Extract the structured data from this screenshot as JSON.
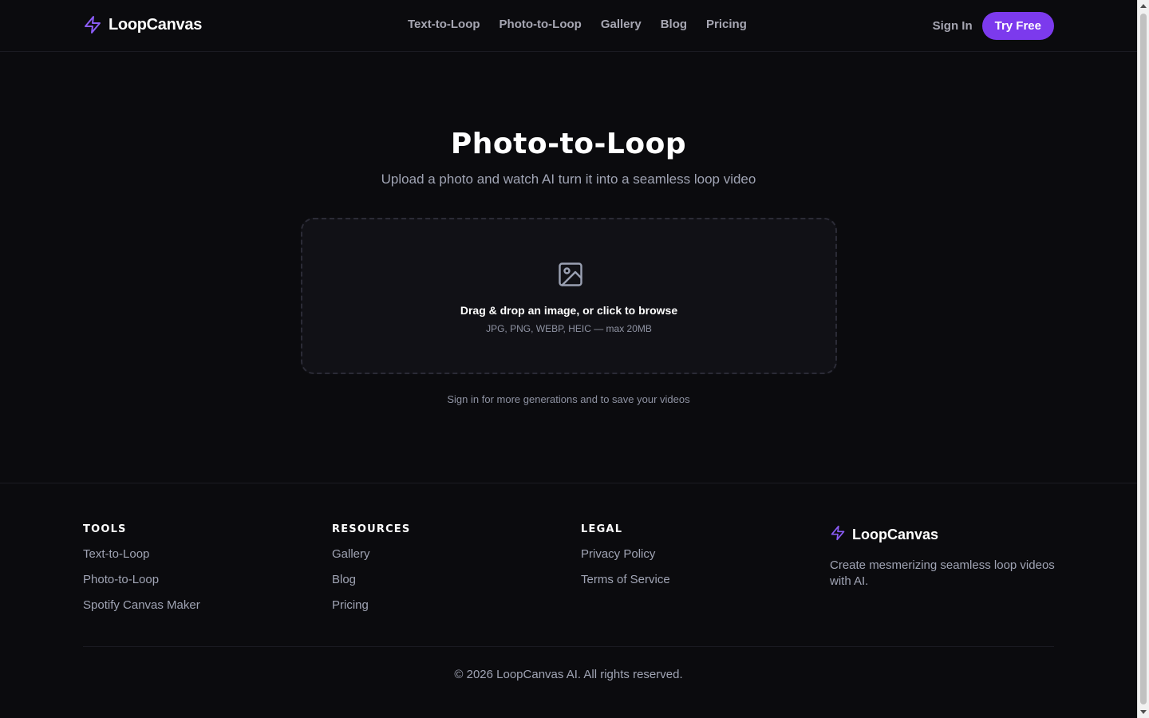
{
  "header": {
    "brand": "LoopCanvas",
    "nav": [
      "Text-to-Loop",
      "Photo-to-Loop",
      "Gallery",
      "Blog",
      "Pricing"
    ],
    "sign_in": "Sign In",
    "try_free": "Try Free"
  },
  "hero": {
    "title": "Photo-to-Loop",
    "subtitle": "Upload a photo and watch AI turn it into a seamless loop video"
  },
  "upload": {
    "icon": "image-icon",
    "title": "Drag & drop an image, or click to browse",
    "hint": "JPG, PNG, WEBP, HEIC — max 20MB"
  },
  "note": "Sign in for more generations and to save your videos",
  "footer": {
    "tools": {
      "heading": "TOOLS",
      "links": [
        "Text-to-Loop",
        "Photo-to-Loop",
        "Spotify Canvas Maker"
      ]
    },
    "resources": {
      "heading": "RESOURCES",
      "links": [
        "Gallery",
        "Blog",
        "Pricing"
      ]
    },
    "legal": {
      "heading": "LEGAL",
      "links": [
        "Privacy Policy",
        "Terms of Service"
      ]
    },
    "brand": "LoopCanvas",
    "tagline": "Create mesmerizing seamless loop videos with AI.",
    "copyright": "© 2026 LoopCanvas AI. All rights reserved."
  },
  "colors": {
    "accent": "#7c3aed",
    "background": "#0b0b0e",
    "muted_text": "#a0a4b4"
  },
  "icons": {
    "brand": "lightning-bolt-icon",
    "upload": "image-icon"
  }
}
